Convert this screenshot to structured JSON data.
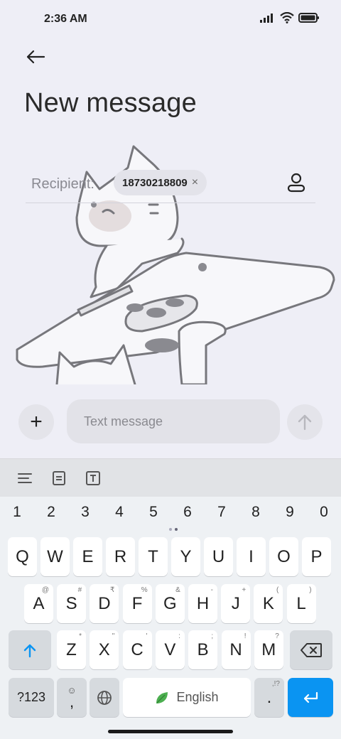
{
  "status": {
    "time": "2:36 AM"
  },
  "header": {
    "title": "New message"
  },
  "recipient": {
    "label": "Recipient:",
    "chip_number": "18730218809",
    "chip_close": "×"
  },
  "compose": {
    "placeholder": "Text message",
    "plus_symbol": "+"
  },
  "keyboard": {
    "numbers": [
      "1",
      "2",
      "3",
      "4",
      "5",
      "6",
      "7",
      "8",
      "9",
      "0"
    ],
    "row1": [
      {
        "k": "Q",
        "h": ""
      },
      {
        "k": "W",
        "h": ""
      },
      {
        "k": "E",
        "h": ""
      },
      {
        "k": "R",
        "h": ""
      },
      {
        "k": "T",
        "h": ""
      },
      {
        "k": "Y",
        "h": ""
      },
      {
        "k": "U",
        "h": ""
      },
      {
        "k": "I",
        "h": ""
      },
      {
        "k": "O",
        "h": ""
      },
      {
        "k": "P",
        "h": ""
      }
    ],
    "row2": [
      {
        "k": "A",
        "h": "@"
      },
      {
        "k": "S",
        "h": "#"
      },
      {
        "k": "D",
        "h": "₹"
      },
      {
        "k": "F",
        "h": "%"
      },
      {
        "k": "G",
        "h": "&"
      },
      {
        "k": "H",
        "h": "-"
      },
      {
        "k": "J",
        "h": "+"
      },
      {
        "k": "K",
        "h": "("
      },
      {
        "k": "L",
        "h": ")"
      }
    ],
    "row3": [
      {
        "k": "Z",
        "h": "*"
      },
      {
        "k": "X",
        "h": "\""
      },
      {
        "k": "C",
        "h": "'"
      },
      {
        "k": "V",
        "h": ":"
      },
      {
        "k": "B",
        "h": ";"
      },
      {
        "k": "N",
        "h": "!"
      },
      {
        "k": "M",
        "h": "?"
      }
    ],
    "sym_label": "?123",
    "comma_label": ",",
    "space_label": "English",
    "period_label": ".",
    "period_hint": ",!?"
  },
  "colors": {
    "accent": "#0a94f2",
    "background": "#eeeef6"
  }
}
